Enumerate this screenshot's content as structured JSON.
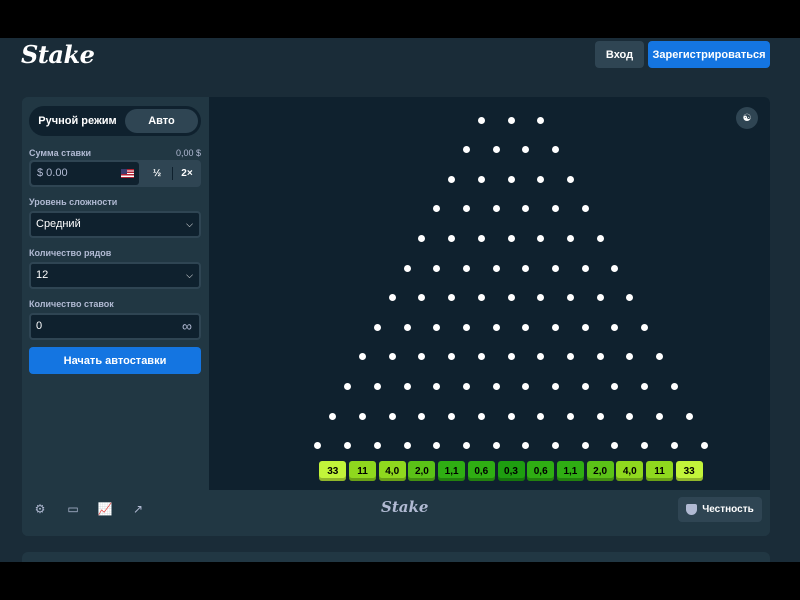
{
  "header": {
    "logo": "Stake",
    "login_label": "Вход",
    "register_label": "Зарегистрироваться"
  },
  "sidebar": {
    "mode_manual": "Ручной режим",
    "mode_auto": "Авто",
    "mode_selected": "Авто",
    "bet_label": "Сумма ставки",
    "bet_balance": "0,00 $",
    "bet_value": "$ 0.00",
    "half_label": "½",
    "double_label": "2×",
    "risk_label": "Уровень сложности",
    "risk_value": "Средний",
    "rows_label": "Количество рядов",
    "rows_value": "12",
    "bets_label": "Количество ставок",
    "bets_value": "0",
    "start_label": "Начать автоставки"
  },
  "board": {
    "rows": 12,
    "multipliers": [
      "33",
      "11",
      "4,0",
      "2,0",
      "1,1",
      "0,6",
      "0,3",
      "0,6",
      "1,1",
      "2,0",
      "4,0",
      "11",
      "33"
    ],
    "colors": {
      "edge": "#c2f43a",
      "mid_high": "#8fd81e",
      "mid": "#5bc217",
      "low": "#2fae13",
      "center": "#1e9e10"
    }
  },
  "footer": {
    "logo": "Stake",
    "fairness_label": "Честность",
    "icons": [
      "settings-icon",
      "theatre-mode-icon",
      "stats-icon",
      "popout-icon"
    ]
  }
}
